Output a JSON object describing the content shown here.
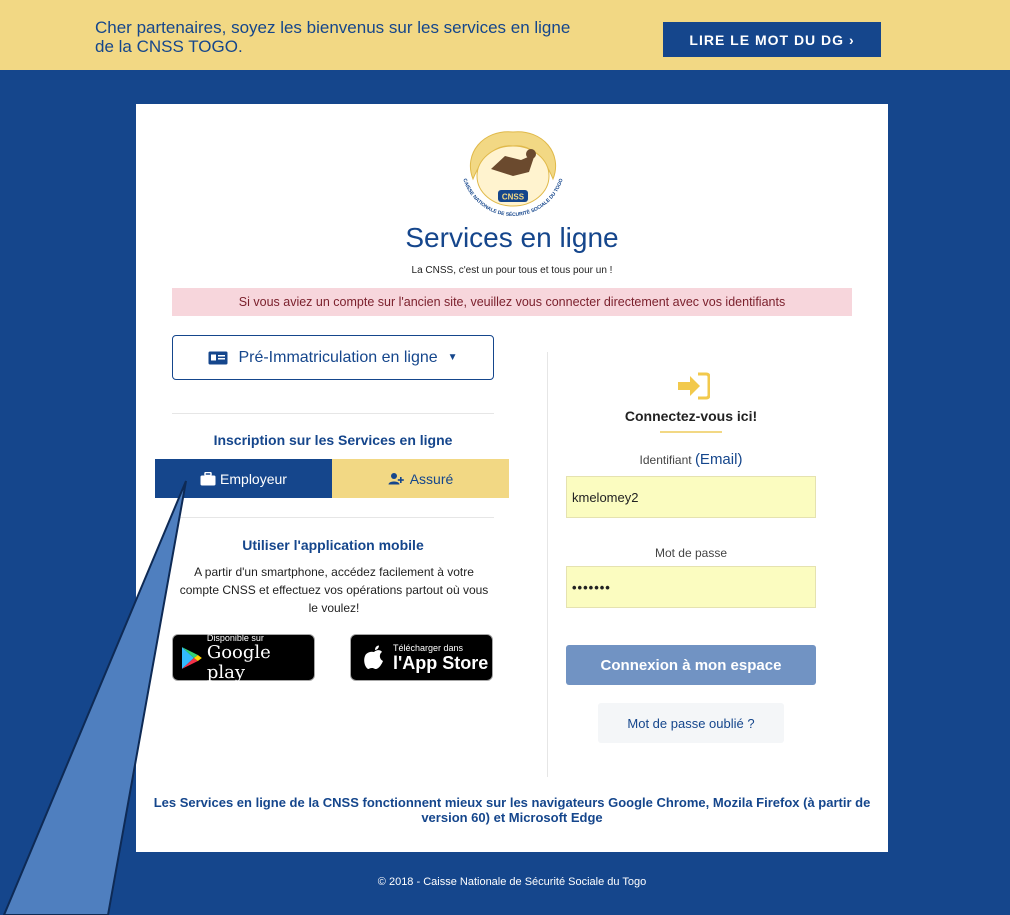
{
  "topbar": {
    "message_line1": "Cher partenaires, soyez les bienvenus sur les services en ligne",
    "message_line2": "de la CNSS TOGO.",
    "dg_button_label": "LIRE LE MOT DU DG ›"
  },
  "logo": {
    "text_ring": "CAISSE NATIONALE DE SÉCURITÉ SOCIALE DU TOGO",
    "text_center": "CNSS"
  },
  "header": {
    "title": "Services en ligne",
    "tagline": "La CNSS, c'est un pour tous et tous pour un !",
    "alert": "Si vous aviez un compte sur l'ancien site, veuillez vous connecter directement avec vos identifiants"
  },
  "left": {
    "preimm_label": "Pré-Immatriculation en ligne",
    "inscription_title": "Inscription sur les Services en ligne",
    "employeur_label": "Employeur",
    "assure_label": "Assuré",
    "mobile_title": "Utiliser l'application mobile",
    "mobile_desc": "A partir d'un smartphone, accédez facilement à votre compte CNSS et effectuez vos opérations partout où vous le voulez!",
    "gplay_small": "Disponible sur",
    "gplay_big": "Google play",
    "appstore_small": "Télécharger dans",
    "appstore_big": "l'App Store"
  },
  "login": {
    "title": "Connectez-vous ici!",
    "id_label": "Identifiant",
    "id_label_email": "(Email)",
    "id_value": "kmelomey2",
    "pwd_label": "Mot de passe",
    "pwd_value": "•••••••",
    "connect_label": "Connexion à mon espace",
    "forgot_label": "Mot de passe oublié ?"
  },
  "browser_note": "Les Services en ligne de la CNSS fonctionnent mieux sur les navigateurs Google Chrome, Mozila Firefox (à partir de version 60) et Microsoft Edge",
  "footer": "© 2018 - Caisse Nationale de Sécurité Sociale du Togo",
  "colors": {
    "brand_blue": "#15468c",
    "brand_yellow": "#f2d884",
    "alert_bg": "#f7d6dc",
    "input_bg": "#fbfcc0",
    "connect_btn": "#7193c3"
  }
}
